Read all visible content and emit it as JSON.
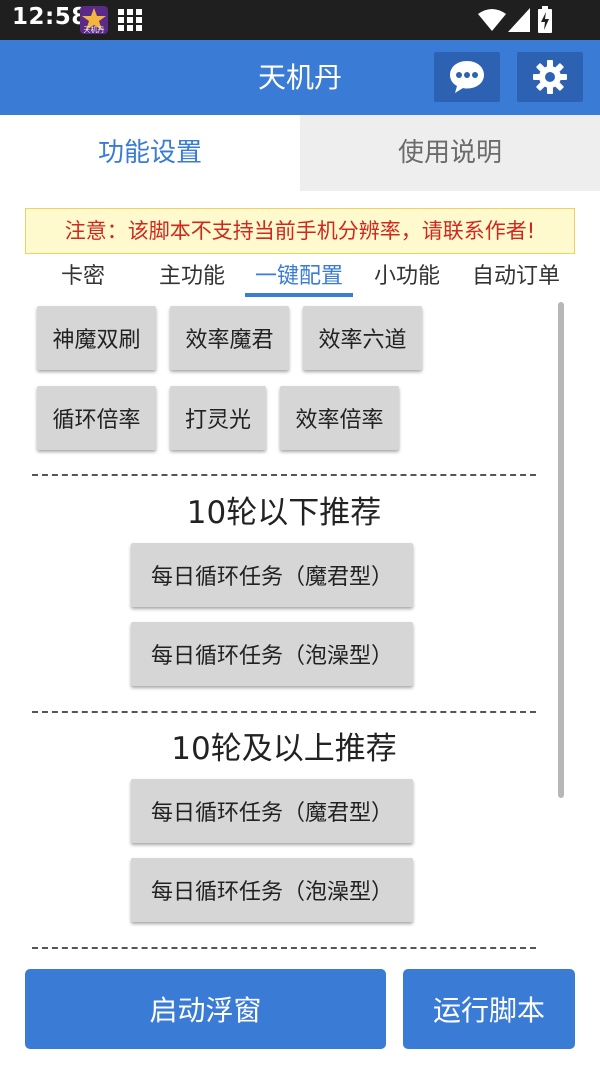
{
  "status_bar": {
    "time": "12:58",
    "app_icon_text": "天机丹",
    "icons": [
      "app-icon",
      "grid-icon",
      "wifi-icon",
      "signal-icon",
      "battery-charging-icon"
    ]
  },
  "app_bar": {
    "title": "天机丹",
    "icons": [
      "chat-icon",
      "gear-icon"
    ]
  },
  "top_tabs": [
    {
      "label": "功能设置",
      "active": true
    },
    {
      "label": "使用说明",
      "active": false
    }
  ],
  "warning": "注意：该脚本不支持当前手机分辨率，请联系作者!",
  "sub_tabs": [
    {
      "label": "卡密",
      "active": false
    },
    {
      "label": "主功能",
      "active": false
    },
    {
      "label": "一键配置",
      "active": true
    },
    {
      "label": "小功能",
      "active": false
    },
    {
      "label": "自动订单",
      "active": false
    }
  ],
  "config_buttons": {
    "row1": [
      "神魔双刷",
      "效率魔君",
      "效率六道"
    ],
    "row2": [
      "循环倍率",
      "打灵光",
      "效率倍率"
    ]
  },
  "sections": [
    {
      "title": "10轮以下推荐",
      "buttons": [
        "每日循环任务（魔君型）",
        "每日循环任务（泡澡型）"
      ]
    },
    {
      "title": "10轮及以上推荐",
      "buttons": [
        "每日循环任务（魔君型）",
        "每日循环任务（泡澡型）"
      ]
    }
  ],
  "bottom_buttons": {
    "float_window": "启动浮窗",
    "run_script": "运行脚本"
  },
  "colors": {
    "primary": "#3a7bd5",
    "primary_dark": "#2d62b3",
    "status_bar": "#1f1f1f",
    "warning_text": "#d0281f",
    "warning_bg": "#fffacd",
    "button_gray": "#d6d6d6"
  }
}
